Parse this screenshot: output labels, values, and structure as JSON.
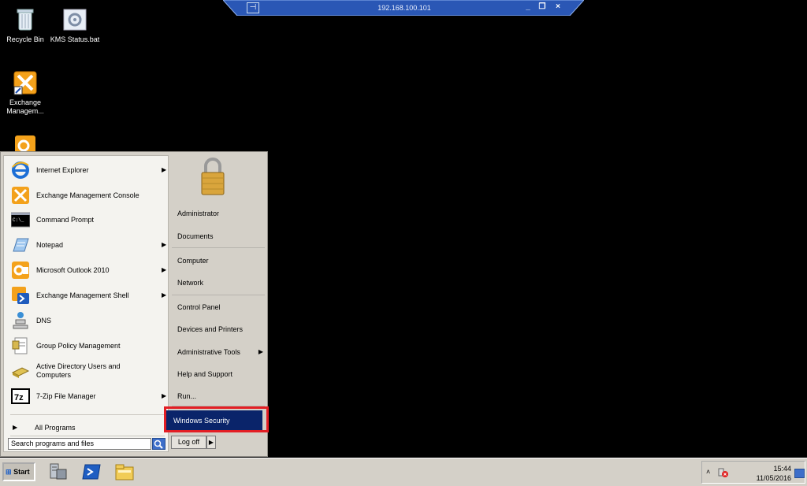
{
  "rdp": {
    "title": "192.168.100.101",
    "minimize": "_",
    "restore": "̓",
    "close": "×"
  },
  "desktop": {
    "icons": [
      {
        "label": "Recycle Bin",
        "icon": "recycle-bin-icon"
      },
      {
        "label": "KMS Status.bat",
        "icon": "batch-file-icon"
      },
      {
        "label": "Exchange Managem...",
        "icon": "exchange-management-icon"
      },
      {
        "label": "",
        "icon": "outlook-icon"
      }
    ]
  },
  "start_menu": {
    "programs": [
      {
        "label": "Internet Explorer",
        "icon": "internet-explorer-icon",
        "submenu": true
      },
      {
        "label": "Exchange Management Console",
        "icon": "exchange-console-icon",
        "submenu": false
      },
      {
        "label": "Command Prompt",
        "icon": "command-prompt-icon",
        "submenu": false
      },
      {
        "label": "Notepad",
        "icon": "notepad-icon",
        "submenu": true
      },
      {
        "label": "Microsoft Outlook 2010",
        "icon": "outlook-icon",
        "submenu": true
      },
      {
        "label": "Exchange Management Shell",
        "icon": "exchange-shell-icon",
        "submenu": true
      },
      {
        "label": "DNS",
        "icon": "dns-icon",
        "submenu": false
      },
      {
        "label": "Group Policy Management",
        "icon": "group-policy-icon",
        "submenu": false
      },
      {
        "label": "Active Directory Users and Computers",
        "icon": "active-directory-icon",
        "submenu": false
      },
      {
        "label": "7-Zip File Manager",
        "icon": "7zip-icon",
        "submenu": true
      }
    ],
    "all_programs": "All Programs",
    "search_placeholder": "Search programs and files",
    "right_items": [
      {
        "label": "Administrator"
      },
      {
        "label": "Documents"
      },
      {
        "label": "Computer"
      },
      {
        "label": "Network"
      },
      {
        "label": "Control Panel"
      },
      {
        "label": "Devices and Printers"
      },
      {
        "label": "Administrative Tools",
        "submenu": true
      },
      {
        "label": "Help and Support"
      },
      {
        "label": "Run..."
      },
      {
        "label": "Windows Security",
        "selected": true
      }
    ],
    "logoff": "Log off"
  },
  "taskbar": {
    "start_label": "Start",
    "pinned": [
      "server-manager-icon",
      "powershell-icon",
      "explorer-folder-icon"
    ],
    "clock_time": "15:44",
    "clock_date": "11/05/2016"
  },
  "colors": {
    "selection": "#0a246a",
    "highlight_box": "#e31e24",
    "rdp_bar": "#2a57b5"
  }
}
